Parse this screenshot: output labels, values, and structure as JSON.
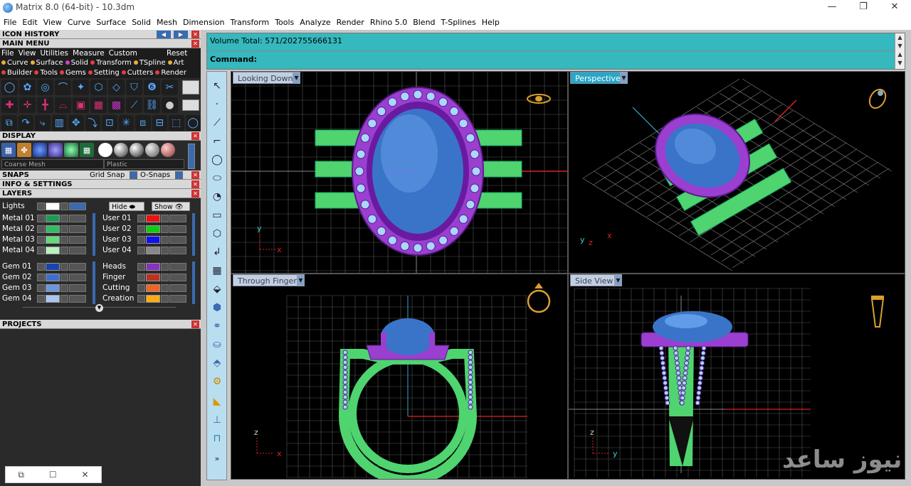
{
  "window": {
    "title": "Matrix 8.0 (64-bit) - 10.3dm",
    "minimize": "—",
    "maximize": "❐",
    "close": "✕"
  },
  "menu": [
    "File",
    "Edit",
    "View",
    "Curve",
    "Surface",
    "Solid",
    "Mesh",
    "Dimension",
    "Transform",
    "Tools",
    "Analyze",
    "Render",
    "Rhino 5.0",
    "Blend",
    "T-Splines",
    "Help"
  ],
  "panel": {
    "icon_history": "ICON HISTORY",
    "main_menu": "MAIN MENU",
    "main_menu_items": [
      "File",
      "View",
      "Utilities",
      "Measure",
      "Custom"
    ],
    "reset": "Reset",
    "categories1": [
      {
        "label": "Curve",
        "color": "#e8b030"
      },
      {
        "label": "Surface",
        "color": "#e8b030"
      },
      {
        "label": "Solid",
        "color": "#d040d0"
      },
      {
        "label": "Transform",
        "color": "#e04040"
      },
      {
        "label": "TSpline",
        "color": "#e8b030"
      },
      {
        "label": "Art",
        "color": "#e8b030"
      }
    ],
    "categories2": [
      {
        "label": "Builder",
        "color": "#e04040"
      },
      {
        "label": "Tools",
        "color": "#e04040"
      },
      {
        "label": "Gems",
        "color": "#e04040"
      },
      {
        "label": "Setting",
        "color": "#e04040"
      },
      {
        "label": "Cutters",
        "color": "#e04040"
      },
      {
        "label": "Render",
        "color": "#e04040"
      }
    ],
    "display": "DISPLAY",
    "mesh_select": "Coarse Mesh",
    "material_select": "Plastic",
    "snaps": "SNAPS",
    "grid_snap": "Grid Snap",
    "o_snaps": "O-Snaps",
    "info_settings": "INFO & SETTINGS",
    "layers": "LAYERS",
    "lights": "Lights",
    "hide": "Hide",
    "show": "Show",
    "projects": "PROJECTS",
    "layers_left": [
      {
        "name": "Metal 01",
        "color": "#1f9a55"
      },
      {
        "name": "Metal 02",
        "color": "#33bb66"
      },
      {
        "name": "Metal 03",
        "color": "#66d97a"
      },
      {
        "name": "Metal 04",
        "color": "#b8f0c0"
      },
      {
        "name": "Gem 01",
        "color": "#1a44aa"
      },
      {
        "name": "Gem 02",
        "color": "#3e6fd0"
      },
      {
        "name": "Gem 03",
        "color": "#6a96e0"
      },
      {
        "name": "Gem 04",
        "color": "#a8c4f0"
      }
    ],
    "layers_right": [
      {
        "name": "User 01",
        "color": "#ee1111"
      },
      {
        "name": "User 02",
        "color": "#11cc11"
      },
      {
        "name": "User 03",
        "color": "#1111ee"
      },
      {
        "name": "User 04",
        "color": "#888888"
      },
      {
        "name": "Heads",
        "color": "#8833bb"
      },
      {
        "name": "Finger",
        "color": "#bb3322"
      },
      {
        "name": "Cutting",
        "color": "#ee6622"
      },
      {
        "name": "Creation",
        "color": "#ffaa11"
      }
    ]
  },
  "command": {
    "volume": "Volume Total: 571/202755666131",
    "prompt": "Command:"
  },
  "viewports": [
    {
      "label": "Looking Down",
      "active": false
    },
    {
      "label": "Perspective",
      "active": true
    },
    {
      "label": "Through Finger",
      "active": false
    },
    {
      "label": "Side View",
      "active": false
    }
  ],
  "axes": {
    "y": "y",
    "x": "x",
    "z": "z"
  },
  "watermark": "نیوز ساعد",
  "colors": {
    "panel_bg": "#2a2a2a",
    "command_bg": "#35b8be",
    "metal_green": "#4fd470",
    "head_purple": "#9a3fd0",
    "gem_blue": "#3a74c8"
  }
}
